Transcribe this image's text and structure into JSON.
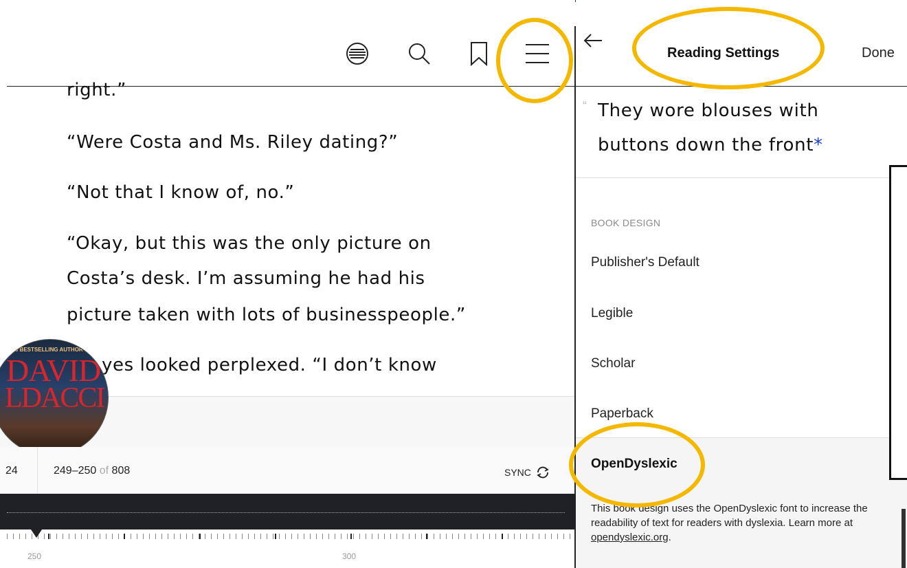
{
  "reader": {
    "toolbar": {
      "icons": [
        "contents-icon",
        "search-icon",
        "bookmark-icon",
        "menu-icon"
      ]
    },
    "paragraphs": [
      "right.”",
      "“Were Costa and Ms. Riley dating?”",
      "“Not that I know of, no.”",
      "“Okay, but this was the only picture on",
      "Costa’s desk. I’m assuming he had his",
      "picture taken with lots of businesspeople.”",
      "yes looked perplexed. “I don’t know"
    ],
    "cover": {
      "tagline": "MES BESTSELLING AUTHOR OF",
      "author_line1": "DAVID",
      "author_line2": "LDACCI"
    },
    "progress": {
      "left_value": "24",
      "pages": "249–250",
      "of_label": "of",
      "total": "808",
      "sync_label": "SYNC"
    },
    "timeline": {
      "labels": [
        "250",
        "300"
      ]
    }
  },
  "settings": {
    "back_icon": "back-arrow-icon",
    "title": "Reading Settings",
    "done_label": "Done",
    "preview_line1": "They wore blouses with",
    "preview_line2": "buttons down the front",
    "preview_asterisk": "*",
    "section_label": "BOOK DESIGN",
    "options": [
      "Publisher's Default",
      "Legible",
      "Scholar",
      "Paperback"
    ],
    "selected_option": "OpenDyslexic",
    "description": "This book design uses the OpenDyslexic font to increase the readability of text for readers with dyslexia. Learn more at ",
    "description_link": "opendyslexic.org",
    "description_end": "."
  },
  "colors": {
    "highlight": "#f5b800",
    "asterisk": "#1a3fcc",
    "dark_band": "#1f2127"
  }
}
